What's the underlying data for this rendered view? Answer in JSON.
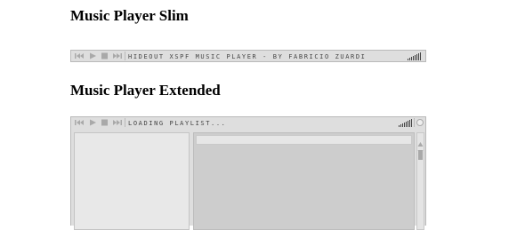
{
  "sections": {
    "slim": {
      "heading": "Music Player Slim",
      "title_text": "HIDEOUT XSPF MUSIC PLAYER - BY FABRICIO ZUARDI"
    },
    "extended": {
      "heading": "Music Player Extended",
      "title_text": "LOADING PLAYLIST..."
    }
  },
  "icons": {
    "previous": "previous-icon",
    "play": "play-icon",
    "stop": "stop-icon",
    "next": "next-icon",
    "volume": "volume-icon",
    "info": "info-button"
  },
  "colors": {
    "bar_bg": "#dedede",
    "bar_border": "#b9b9b9",
    "icon": "#a9a9a9",
    "text": "#444444",
    "playlist_bg": "#cdcdcd"
  }
}
